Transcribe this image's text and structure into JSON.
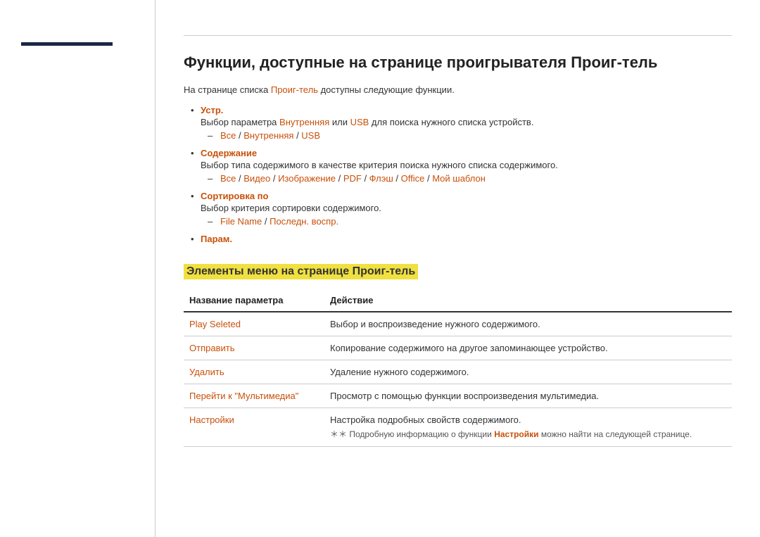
{
  "sidebar": {
    "accent": ""
  },
  "page": {
    "top_divider": true,
    "title": "Функции, доступные на странице проигрывателя Проиг-тель",
    "intro": "На странице списка ",
    "intro_link": "Проиг-тель",
    "intro_suffix": " доступны следующие функции.",
    "bullet_items": [
      {
        "label": "Устр.",
        "description": "Выбор параметра ",
        "desc_link1": "Внутренняя",
        "desc_middle": " или ",
        "desc_link2": "USB",
        "desc_suffix": " для поиска нужного списка устройств.",
        "sub_items": [
          {
            "link1": "Все",
            "sep1": " / ",
            "link2": "Внутренняя",
            "sep2": " / ",
            "link3": "USB"
          }
        ]
      },
      {
        "label": "Содержание",
        "description": "Выбор типа содержимого в качестве критерия поиска нужного списка содержимого.",
        "sub_items": [
          {
            "parts": [
              "Все",
              "Видео",
              "Изображение",
              "PDF",
              "Флэш",
              "Office",
              "Мой шаблон"
            ],
            "seps": [
              " / ",
              " / ",
              " / ",
              " / ",
              " / ",
              " / "
            ]
          }
        ]
      },
      {
        "label": "Сортировка по",
        "description": "Выбор критерия сортировки содержимого.",
        "sub_items": [
          {
            "parts": [
              "File Name",
              "Последн. воспр."
            ],
            "seps": [
              " / "
            ]
          }
        ]
      },
      {
        "label": "Парам."
      }
    ],
    "section_heading": "Элементы меню на странице Проиг-тель",
    "table": {
      "col1_header": "Название параметра",
      "col2_header": "Действие",
      "rows": [
        {
          "name": "Play Seleted",
          "action": "Выбор и воспроизведение нужного содержимого."
        },
        {
          "name": "Отправить",
          "action": "Копирование содержимого на другое запоминающее устройство."
        },
        {
          "name": "Удалить",
          "action": "Удаление нужного содержимого."
        },
        {
          "name": "Перейти к \"Мультимедиа\"",
          "action": "Просмотр с помощью функции воспроизведения мультимедиа."
        },
        {
          "name": "Настройки",
          "action": "Настройка подробных свойств содержимого.",
          "note_prefix": "＊＊ Подробную информацию о функции ",
          "note_link": "Настройки",
          "note_suffix": " можно найти на следующей странице."
        }
      ]
    }
  }
}
